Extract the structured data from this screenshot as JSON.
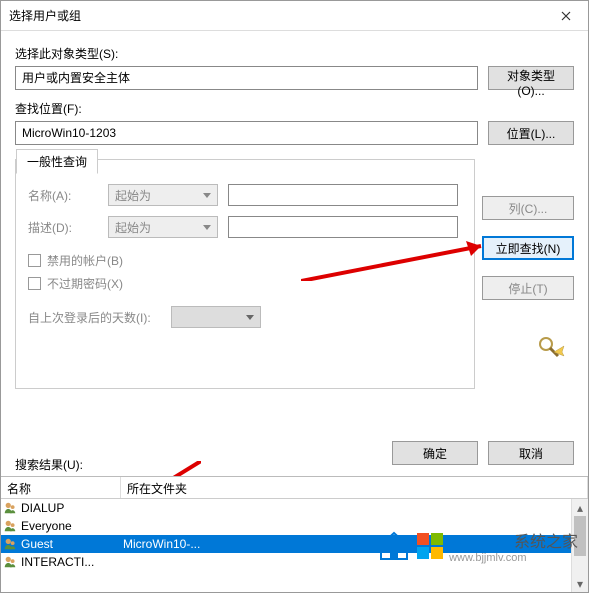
{
  "titlebar": {
    "title": "选择用户或组"
  },
  "object_type": {
    "label": "选择此对象类型(S):",
    "value": "用户或内置安全主体",
    "button": "对象类型(O)..."
  },
  "location": {
    "label": "查找位置(F):",
    "value": "MicroWin10-1203",
    "button": "位置(L)..."
  },
  "general_query": {
    "tab": "一般性查询",
    "name_label": "名称(A):",
    "desc_label": "描述(D):",
    "combo_value": "起始为",
    "disabled_account": "禁用的帐户(B)",
    "no_expire_pwd": "不过期密码(X)",
    "days_label": "自上次登录后的天数(I):"
  },
  "buttons": {
    "columns": "列(C)...",
    "find_now": "立即查找(N)",
    "stop": "停止(T)",
    "ok": "确定",
    "cancel": "取消"
  },
  "results": {
    "label": "搜索结果(U):",
    "col_name": "名称",
    "col_folder": "所在文件夹",
    "rows": [
      {
        "name": "DIALUP",
        "folder": ""
      },
      {
        "name": "Everyone",
        "folder": ""
      },
      {
        "name": "Guest",
        "folder": "MicroWin10-..."
      },
      {
        "name": "INTERACTI...",
        "folder": ""
      }
    ],
    "selected_index": 2
  },
  "watermark": {
    "brand": "Windows",
    "suffix": "系统之家",
    "url": "www.bjjmlv.com"
  }
}
